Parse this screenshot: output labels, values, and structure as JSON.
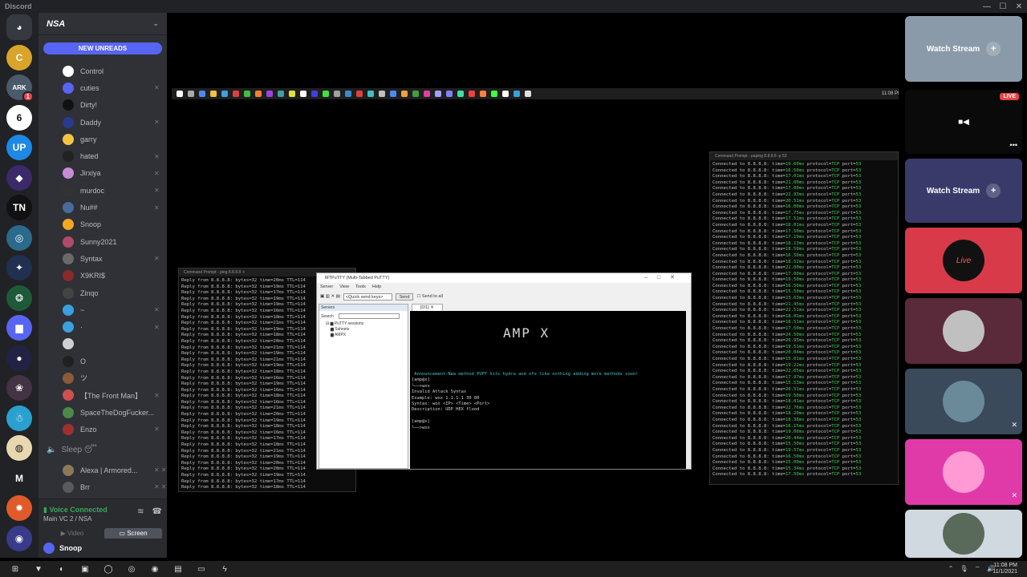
{
  "window": {
    "title": "Discord",
    "controls": [
      "—",
      "☐",
      "✕"
    ]
  },
  "rail": {
    "servers": [
      {
        "icon": "discord-home-icon",
        "glyph": "◕",
        "color": "#36393f"
      },
      {
        "icon": "server-cheat",
        "glyph": "C",
        "color": "#d9a42a"
      },
      {
        "icon": "server-ark",
        "glyph": "ARK",
        "color": "#4a5a6a",
        "badge": "1"
      },
      {
        "icon": "server-6",
        "glyph": "6",
        "color": "#ffffff"
      },
      {
        "icon": "server-up",
        "glyph": "UP",
        "color": "#1e88e5"
      },
      {
        "icon": "server-purple",
        "glyph": "◆",
        "color": "#3a2a6a"
      },
      {
        "icon": "server-tn",
        "glyph": "TN",
        "color": "#111111"
      },
      {
        "icon": "server-globe",
        "glyph": "◎",
        "color": "#2a6a8a"
      },
      {
        "icon": "server-night",
        "glyph": "✦",
        "color": "#203050"
      },
      {
        "icon": "server-green",
        "glyph": "❂",
        "color": "#1e5a3a"
      },
      {
        "icon": "folder-icon",
        "glyph": "▆",
        "color": "#5865f2"
      },
      {
        "icon": "server-dark",
        "glyph": "●",
        "color": "#222244"
      },
      {
        "icon": "server-anime",
        "glyph": "❀",
        "color": "#443344"
      },
      {
        "icon": "server-snow",
        "glyph": "☃",
        "color": "#2aa0d0"
      },
      {
        "icon": "server-cream",
        "glyph": "◍",
        "color": "#e8d8b0"
      },
      {
        "icon": "server-m",
        "glyph": "M",
        "color": "#202225"
      },
      {
        "icon": "server-fire",
        "glyph": "✹",
        "color": "#e05a2a"
      },
      {
        "icon": "server-eye",
        "glyph": "◉",
        "color": "#3a3a8a"
      }
    ]
  },
  "guild": {
    "name": "NSA",
    "new_unreads": "NEW UNREADS"
  },
  "members": [
    {
      "name": "Control",
      "color": "#ffffff",
      "mute": ""
    },
    {
      "name": "cuties",
      "color": "#5865f2",
      "mute": "✕"
    },
    {
      "name": "Dirty!",
      "color": "#111111",
      "mute": ""
    },
    {
      "name": "Daddy",
      "color": "#2a3a8a",
      "mute": "✕"
    },
    {
      "name": "garry",
      "color": "#f5c542",
      "mute": ""
    },
    {
      "name": "hated",
      "color": "#222222",
      "mute": "✕"
    },
    {
      "name": "Jirxiya",
      "color": "#c98bd9",
      "mute": "✕"
    },
    {
      "name": "murdoc",
      "color": "#333333",
      "mute": "✕"
    },
    {
      "name": "Nu##",
      "color": "#4a6a9a",
      "mute": "✕"
    },
    {
      "name": "Snoop",
      "color": "#f5a623",
      "mute": ""
    },
    {
      "name": "Sunny2021",
      "color": "#b04a6a",
      "mute": ""
    },
    {
      "name": "Syntax",
      "color": "#6a6a6a",
      "mute": "✕"
    },
    {
      "name": "X9KRI$",
      "color": "#8a2a2a",
      "mute": ""
    },
    {
      "name": "Zinqo",
      "color": "#444444",
      "mute": ""
    },
    {
      "name": "~",
      "color": "#3aa0e0",
      "mute": "✕"
    },
    {
      "name": "·",
      "color": "#3aa0e0",
      "mute": "✕"
    },
    {
      "name": "",
      "color": "#d0d0d0",
      "mute": ""
    },
    {
      "name": "O",
      "color": "#202020",
      "mute": ""
    },
    {
      "name": "ツ",
      "color": "#8a5a3a",
      "mute": ""
    },
    {
      "name": "【The Front Man】",
      "color": "#d05050",
      "mute": "✕"
    },
    {
      "name": "SpaceTheDogFucker...",
      "color": "#4a8a4a",
      "mute": ""
    },
    {
      "name": "Enzo",
      "color": "#a03030",
      "mute": "✕"
    }
  ],
  "voice_channel": {
    "name": "Sleep 😴"
  },
  "voice_members": [
    {
      "name": "Alexa | Armored...",
      "color": "#8a7a5a",
      "mute": "✕ ✕"
    },
    {
      "name": "Brr",
      "color": "#5a5a5a",
      "mute": "✕ ✕"
    }
  ],
  "voice_panel": {
    "status": "Voice Connected",
    "channel": "Main VC 2 / NSA",
    "video_label": "Video",
    "screen_label": "Screen"
  },
  "user": {
    "name": "Snoop"
  },
  "stream": {
    "inner_clock": "11:08 PM",
    "cmd1": {
      "title": "Command Prompt - ping 8.8.8.8 -t",
      "line": "Reply from 8.8.8.8: bytes=32 time=",
      "rows": [
        "20ms TTL=114",
        "19ms TTL=114",
        "17ms TTL=114",
        "19ms TTL=114",
        "19ms TTL=114",
        "16ms TTL=114",
        "18ms TTL=114",
        "21ms TTL=114",
        "19ms TTL=114",
        "18ms TTL=114",
        "20ms TTL=114",
        "21ms TTL=114",
        "19ms TTL=114",
        "21ms TTL=114",
        "19ms TTL=114",
        "18ms TTL=114",
        "16ms TTL=114",
        "19ms TTL=114",
        "16ms TTL=114",
        "18ms TTL=114",
        "16ms TTL=114",
        "21ms TTL=114",
        "20ms TTL=114",
        "19ms TTL=114",
        "18ms TTL=114",
        "16ms TTL=114",
        "17ms TTL=114",
        "18ms TTL=114",
        "21ms TTL=114",
        "19ms TTL=114",
        "20ms TTL=114",
        "20ms TTL=114",
        "19ms TTL=114",
        "17ms TTL=114",
        "18ms TTL=114",
        "19ms TTL=114"
      ]
    },
    "cmd2": {
      "title": "Command Prompt - paping 8.8.8.8 -p 53",
      "prefix": "Connected to 8.8.8.8: time=",
      "suffix": "protocol=TCP port=53",
      "times": [
        "19.60ms",
        "16.50ms",
        "17.01ms",
        "21.00ms",
        "17.00ms",
        "22.93ms",
        "20.51ms",
        "16.00ms",
        "17.75ms",
        "17.51ms",
        "18.01ms",
        "17.50ms",
        "17.19ms",
        "18.13ms",
        "18.50ms",
        "16.50ms",
        "18.52ms",
        "22.00ms",
        "17.00ms",
        "19.50ms",
        "16.50ms",
        "15.50ms",
        "23.63ms",
        "21.45ms",
        "22.51ms",
        "18.01ms",
        "18.51ms",
        "17.50ms",
        "24.50ms",
        "20.95ms",
        "19.51ms",
        "20.04ms",
        "15.01ms",
        "19.22ms",
        "22.05ms",
        "17.97ms",
        "15.53ms",
        "20.51ms",
        "19.50ms",
        "18.01ms",
        "22.76ms",
        "18.20ms",
        "18.38ms",
        "16.15ms",
        "19.00ms",
        "20.44ms",
        "15.50ms",
        "19.57ms",
        "16.50ms",
        "15.00ms",
        "15.34ms",
        "17.50ms"
      ]
    },
    "putty": {
      "title": "MTPuTTY (Multi-Tabbed PuTTY)",
      "menu": [
        "Server",
        "View",
        "Tools",
        "Help"
      ],
      "quick_send": "<Quick send keys>",
      "send": "Send",
      "send_all": "Send to all",
      "servers_label": "Servers",
      "search_label": "Search",
      "tree": [
        "PuTTY sessions",
        "Sshnets",
        "AMPX"
      ],
      "tab": "[0/1] ✕",
      "logo": "AMP X",
      "announcement": " Announcement:New method PUFF hits hydra and ofo like nothing adding more methods soon!",
      "lines": [
        "[amp@x]",
        "└──>wox",
        "Invalid Attack Syntax",
        "Example: wox 1.1.1.1 30 80",
        "Syntax: wox <IP> <Time> <Port>",
        "Description: UDP HEX flood",
        "",
        "[amp@x]",
        "└──>wox"
      ]
    }
  },
  "right_tiles": [
    {
      "label": "Watch Stream",
      "bg": "#8a9aa8"
    },
    {
      "label": "LIVE",
      "bg": "#0a0a0a"
    },
    {
      "label": "Watch Stream",
      "bg": "#3a3a6a"
    },
    {
      "label": "Live",
      "bg": "#d83a4a"
    },
    {
      "label": "",
      "bg": "#5a2a3a"
    },
    {
      "label": "",
      "bg": "#3a4a5a"
    },
    {
      "label": "",
      "bg": "#e03aa8"
    },
    {
      "label": "",
      "bg": "#d0d8e0"
    }
  ],
  "taskbar": {
    "apps": [
      "⊞",
      "▼",
      "◐",
      "▣",
      "◯",
      "◎",
      "◉",
      "▤",
      "▭",
      "ϟ"
    ],
    "time": "11:08 PM",
    "date": "11/1/2021"
  }
}
